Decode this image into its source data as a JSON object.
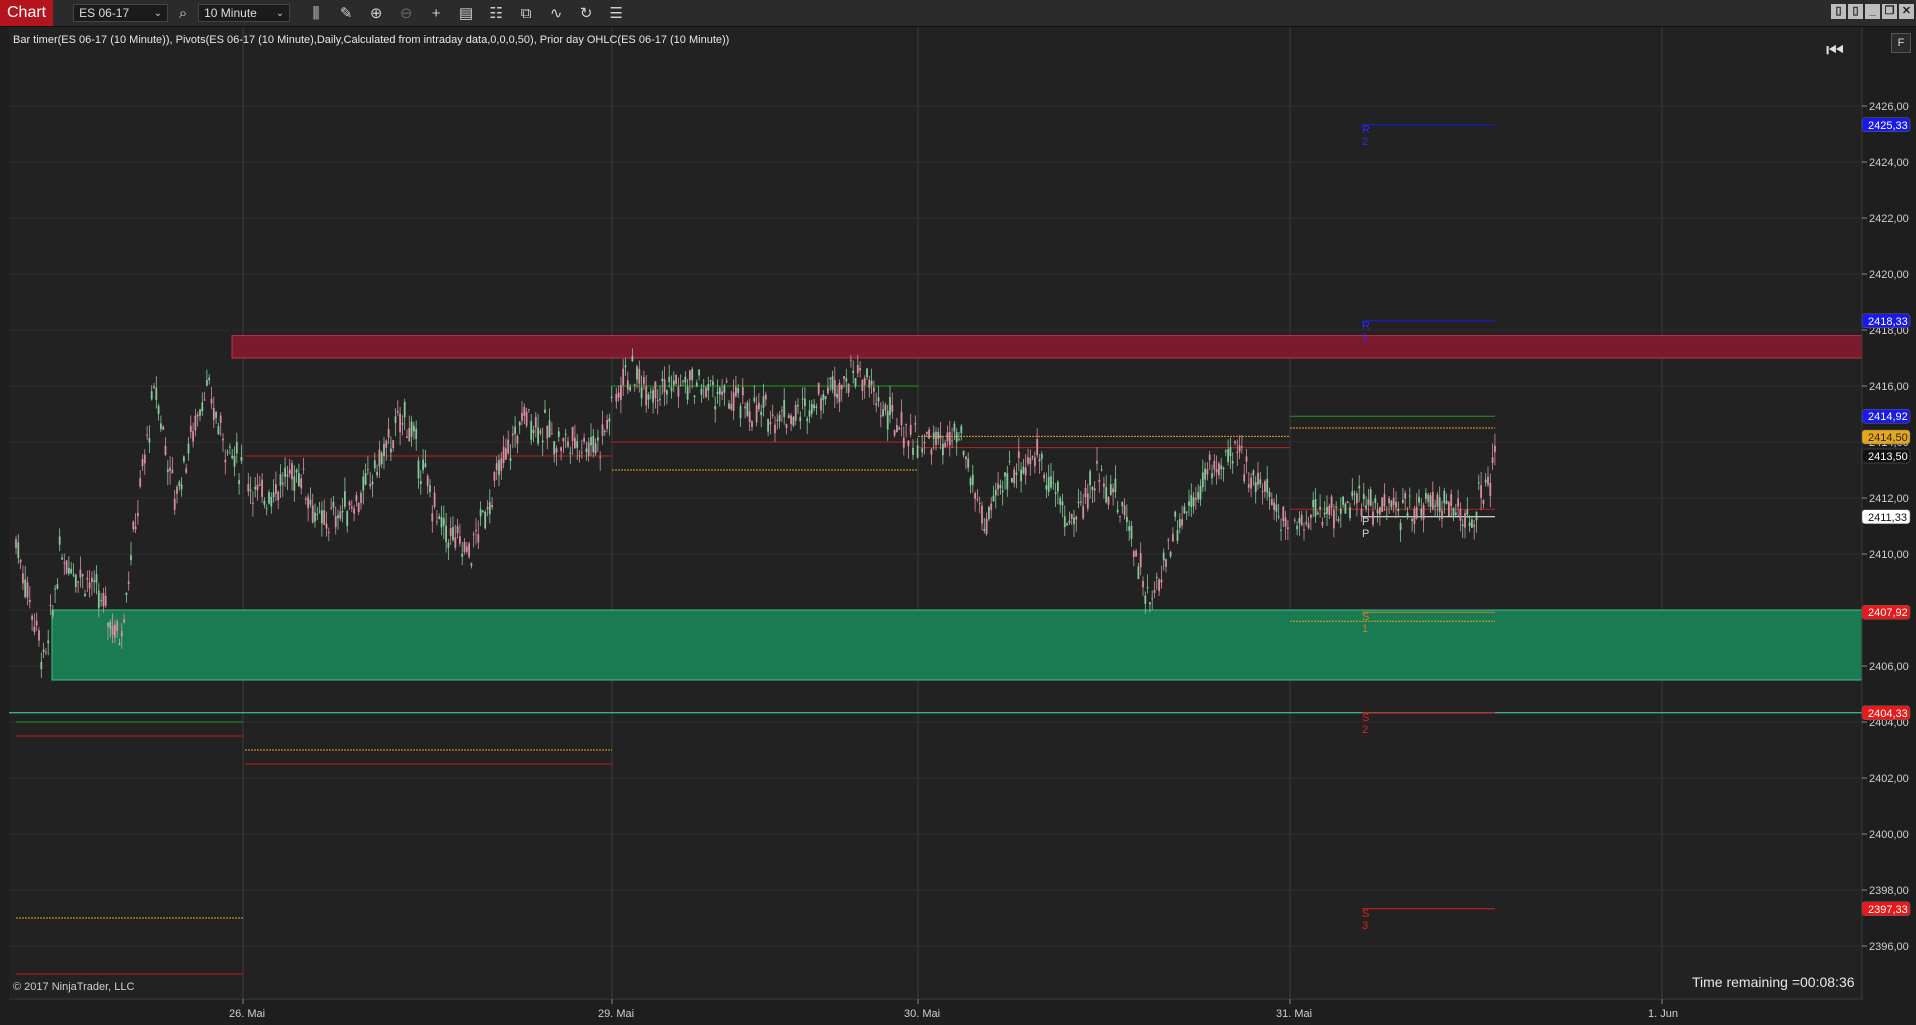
{
  "toolbar": {
    "chart_tab": "Chart",
    "instrument": "ES 06-17",
    "interval": "10 Minute",
    "icons": [
      "search-icon",
      "bars-type-icon",
      "pencil-icon",
      "zoom-in-icon",
      "zoom-out-icon",
      "crosshair-icon",
      "data-box-icon",
      "properties-icon",
      "strategies-icon",
      "indicators-icon",
      "reload-icon",
      "menu-icon"
    ]
  },
  "indicator_line": "Bar timer(ES 06-17 (10 Minute)), Pivots(ES 06-17 (10 Minute),Daily,Calculated from intraday data,0,0,0,50), Prior day OHLC(ES 06-17 (10 Minute))",
  "copyright": "© 2017 NinjaTrader, LLC",
  "time_remaining": "Time remaining =00:08:36",
  "f_badge": "F",
  "price_axis": {
    "ticks": [
      "2426,00",
      "2424,00",
      "2422,00",
      "2420,00",
      "2418,00",
      "2416,00",
      "2414,00",
      "2412,00",
      "2410,00",
      "2408,00",
      "2406,00",
      "2404,00",
      "2402,00",
      "2400,00",
      "2398,00",
      "2396,00"
    ],
    "min": 2394.8,
    "max": 2427.6
  },
  "time_axis": [
    "26. Mai",
    "29. Mai",
    "30. Mai",
    "31. Mai",
    "1. Jun"
  ],
  "price_markers": [
    {
      "label": "2425,33",
      "value": 2425.33,
      "color": "#1a1ae6",
      "text": "#ffffff"
    },
    {
      "label": "2418,33",
      "value": 2418.33,
      "color": "#1a1ae6",
      "text": "#ffffff"
    },
    {
      "label": "2414,92",
      "value": 2414.92,
      "color": "#1a1ae6",
      "text": "#ffffff"
    },
    {
      "label": "2414,50",
      "value": 2414.5,
      "color": "#e6a81a",
      "text": "#222222"
    },
    {
      "label": "2413,50",
      "value": 2413.5,
      "color": "#111111",
      "text": "#ffffff"
    },
    {
      "label": "2411,33",
      "value": 2411.33,
      "color": "#ffffff",
      "text": "#111111"
    },
    {
      "label": "2407,92",
      "value": 2407.92,
      "color": "#e61a1a",
      "text": "#ffffff"
    },
    {
      "label": "2404,33",
      "value": 2404.33,
      "color": "#e61a1a",
      "text": "#ffffff"
    },
    {
      "label": "2397,33",
      "value": 2397.33,
      "color": "#e61a1a",
      "text": "#ffffff"
    }
  ],
  "pivot_labels": [
    {
      "text": "R",
      "sub": "2",
      "value": 2425.33,
      "color": "#2a2aff"
    },
    {
      "text": "R",
      "sub": "1",
      "value": 2418.33,
      "color": "#2a2aff"
    },
    {
      "text": "P",
      "sub": "P",
      "value": 2411.33,
      "color": "#cccccc"
    },
    {
      "text": "S",
      "sub": "1",
      "value": 2407.92,
      "color": "#c08030"
    },
    {
      "text": "S",
      "sub": "2",
      "value": 2404.33,
      "color": "#e02020"
    },
    {
      "text": "S",
      "sub": "3",
      "value": 2397.33,
      "color": "#e02020"
    }
  ],
  "colors": {
    "resistance_zone": "#7a1a2c",
    "support_zone": "#1a7a52",
    "support_line": "#40e0b0",
    "bull_candle": "#86c89a",
    "bear_candle": "#d88ea2"
  }
}
